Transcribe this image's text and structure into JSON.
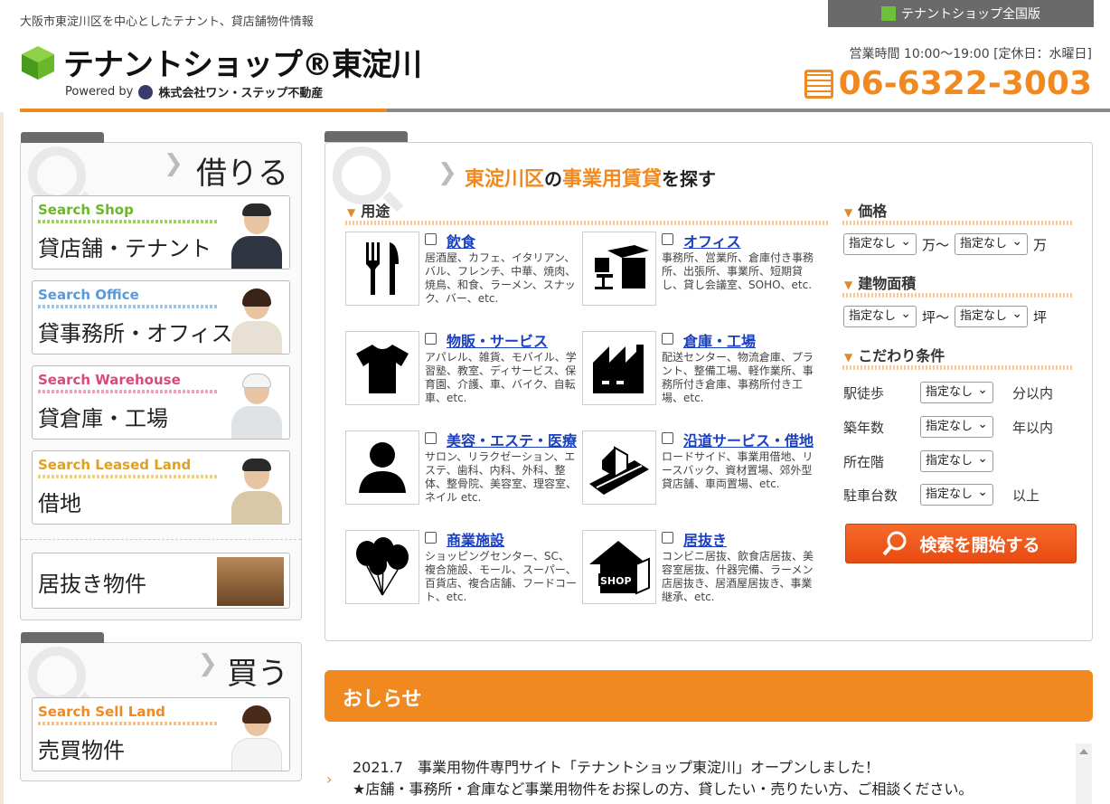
{
  "header": {
    "tagline": "大阪市東淀川区を中心としたテナント、貸店舗物件情報",
    "logo_text": "テナントショップ®東淀川",
    "powered_by": "Powered by",
    "company": "株式会社ワン・ステップ不動産",
    "national_link": "テナントショップ全国版",
    "hours": "営業時間 10:00〜19:00 [定休日：水曜日]",
    "phone": "06-6322-3003"
  },
  "rent_panel": {
    "title": "借りる",
    "cards": [
      {
        "en": "Search Shop",
        "jp": "貸店舗・テナント",
        "color": "#6ab82a"
      },
      {
        "en": "Search Office",
        "jp": "貸事務所・オフィス",
        "color": "#5a9ad6"
      },
      {
        "en": "Search Warehouse",
        "jp": "貸倉庫・工場",
        "color": "#d84a7a"
      },
      {
        "en": "Search Leased Land",
        "jp": "借地",
        "color": "#e0a020"
      }
    ],
    "inuki": "居抜き物件"
  },
  "buy_panel": {
    "title": "買う",
    "card": {
      "en": "Search Sell Land",
      "jp": "売買物件",
      "color": "#f08a20"
    }
  },
  "search": {
    "title_a": "東淀川区",
    "title_b": "の",
    "title_c": "事業用賃貸",
    "title_d": "を探す",
    "use_label": "用途",
    "uses": [
      {
        "name": "飲食",
        "desc": "居酒屋、カフェ、イタリアン、バル、フレンチ、中華、焼肉、焼鳥、和食、ラーメン、スナック、バー、etc.",
        "icon": "fork-knife-icon"
      },
      {
        "name": "オフィス",
        "desc": "事務所、営業所、倉庫付き事務所、出張所、事業所、短期貸し、貸し会議室、SOHO、etc.",
        "icon": "office-desk-icon"
      },
      {
        "name": "物販・サービス",
        "desc": "アパレル、雑貨、モバイル、学習塾、教室、ディサービス、保育園、介護、車、バイク、自転車、etc.",
        "icon": "tshirt-icon"
      },
      {
        "name": "倉庫・工場",
        "desc": "配送センター、物流倉庫、プラント、整備工場、軽作業所、事務所付き倉庫、事務所付き工場、etc.",
        "icon": "factory-icon"
      },
      {
        "name": "美容・エステ・医療",
        "desc": "サロン、リラクゼーション、エステ、歯科、内科、外科、整体、整骨院、美容室、理容室、ネイル etc.",
        "icon": "person-icon"
      },
      {
        "name": "沿道サービス・借地",
        "desc": "ロードサイド、事業用借地、リースバック、資材置場、郊外型貸店舗、車両置場、etc.",
        "icon": "roadside-house-icon"
      },
      {
        "name": "商業施設",
        "desc": "ショッピングセンター、SC、複合施設、モール、スーパー、百貨店、複合店舗、フードコート、etc.",
        "icon": "balloons-icon"
      },
      {
        "name": "居抜き",
        "desc": "コンビニ居抜、飲食店居抜、美容室居抜、什器完備、ラーメン店居抜き、居酒屋居抜き、事業継承、etc.",
        "icon": "shop-house-icon"
      }
    ],
    "price_label": "価格",
    "area_label": "建物面積",
    "cond_label": "こだわり条件",
    "unspecified": "指定なし",
    "man_from": "万〜",
    "man": "万",
    "tsubo_from": "坪〜",
    "tsubo": "坪",
    "conds": [
      {
        "label": "駅徒歩",
        "unit": "分以内"
      },
      {
        "label": "築年数",
        "unit": "年以内"
      },
      {
        "label": "所在階",
        "unit": ""
      },
      {
        "label": "駐車台数",
        "unit": "以上"
      }
    ],
    "search_button": "検索を開始する"
  },
  "news": {
    "title": "おしらせ",
    "line1": "2021.7　事業用物件専門サイト「テナントショップ東淀川」オープンしました！",
    "line2": "★店舗・事務所・倉庫など事業用物件をお探しの方、貸したい・売りたい方、ご相談ください。"
  }
}
